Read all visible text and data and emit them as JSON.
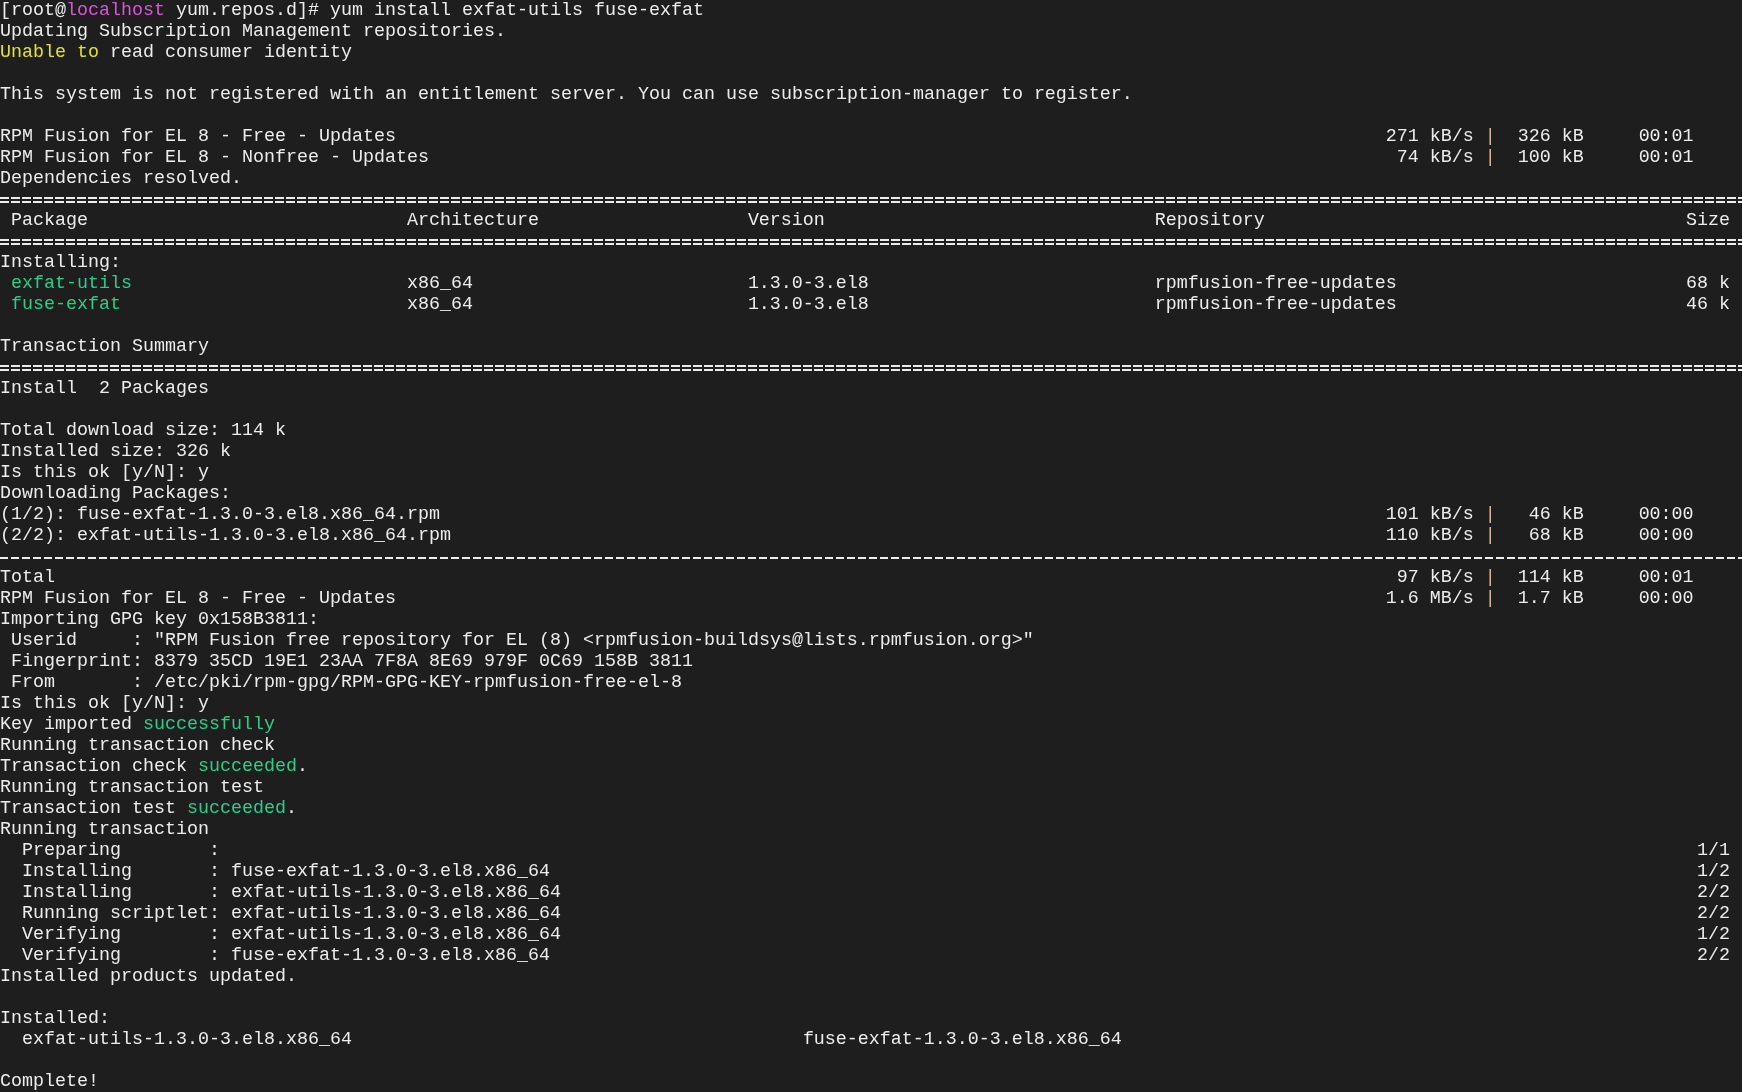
{
  "lines": [
    {
      "kind": "text",
      "segments": [
        {
          "text": "[root@"
        },
        {
          "text": "localhost",
          "color": "#e050e0"
        },
        {
          "text": " yum.repos.d]# yum install exfat-utils fuse-exfat"
        }
      ]
    },
    {
      "kind": "text",
      "segments": [
        {
          "text": "Updating Subscription Management repositories."
        }
      ]
    },
    {
      "kind": "text",
      "segments": [
        {
          "text": "Unable to",
          "color": "#e5e510"
        },
        {
          "text": " read consumer identity"
        }
      ]
    },
    {
      "kind": "blank"
    },
    {
      "kind": "text",
      "segments": [
        {
          "text": "This system is not registered with an entitlement server. You can use subscription-manager to register."
        }
      ]
    },
    {
      "kind": "blank"
    },
    {
      "kind": "progress",
      "name": "RPM Fusion for EL 8 - Free - Updates",
      "speed": "271 kB/s",
      "sep": "|",
      "size": "326 kB",
      "time": "00:01"
    },
    {
      "kind": "progress",
      "name": "RPM Fusion for EL 8 - Nonfree - Updates",
      "speed": "74 kB/s",
      "sep": "|",
      "size": "100 kB",
      "time": "00:01"
    },
    {
      "kind": "text",
      "segments": [
        {
          "text": "Dependencies resolved."
        }
      ]
    },
    {
      "kind": "rule_double"
    },
    {
      "kind": "table_header",
      "cells": [
        "Package",
        "Architecture",
        "Version",
        "Repository",
        "Size"
      ]
    },
    {
      "kind": "rule_double"
    },
    {
      "kind": "text",
      "segments": [
        {
          "text": "Installing:"
        }
      ]
    },
    {
      "kind": "table_row",
      "cells": [
        "exfat-utils",
        "x86_64",
        "1.3.0-3.el8",
        "rpmfusion-free-updates",
        "68 k"
      ]
    },
    {
      "kind": "table_row",
      "cells": [
        "fuse-exfat",
        "x86_64",
        "1.3.0-3.el8",
        "rpmfusion-free-updates",
        "46 k"
      ]
    },
    {
      "kind": "blank"
    },
    {
      "kind": "text",
      "segments": [
        {
          "text": "Transaction Summary"
        }
      ]
    },
    {
      "kind": "rule_double"
    },
    {
      "kind": "text",
      "segments": [
        {
          "text": "Install  2 Packages"
        }
      ]
    },
    {
      "kind": "blank"
    },
    {
      "kind": "text",
      "segments": [
        {
          "text": "Total download size: 114 k"
        }
      ]
    },
    {
      "kind": "text",
      "segments": [
        {
          "text": "Installed size: 326 k"
        }
      ]
    },
    {
      "kind": "text",
      "segments": [
        {
          "text": "Is this ok [y/N]: y"
        }
      ]
    },
    {
      "kind": "text",
      "segments": [
        {
          "text": "Downloading Packages:"
        }
      ]
    },
    {
      "kind": "progress",
      "name": "(1/2): fuse-exfat-1.3.0-3.el8.x86_64.rpm",
      "speed": "101 kB/s",
      "sep": "|",
      "size": "46 kB",
      "time": "00:00"
    },
    {
      "kind": "progress",
      "name": "(2/2): exfat-utils-1.3.0-3.el8.x86_64.rpm",
      "speed": "110 kB/s",
      "sep": "|",
      "size": "68 kB",
      "time": "00:00"
    },
    {
      "kind": "rule_single"
    },
    {
      "kind": "progress",
      "name": "Total",
      "speed": "97 kB/s",
      "sep": "|",
      "size": "114 kB",
      "time": "00:01"
    },
    {
      "kind": "progress",
      "name": "RPM Fusion for EL 8 - Free - Updates",
      "speed": "1.6 MB/s",
      "sep": "|",
      "size": "1.7 kB",
      "time": "00:00"
    },
    {
      "kind": "text",
      "segments": [
        {
          "text": "Importing GPG key 0x158B3811:"
        }
      ]
    },
    {
      "kind": "keyval",
      "label": "Userid",
      "sep": ":",
      "value": "\"RPM Fusion free repository for EL (8) <rpmfusion-buildsys@lists.rpmfusion.org>\""
    },
    {
      "kind": "keyval",
      "label": "Fingerprint",
      "sep": ":",
      "value": "8379 35CD 19E1 23AA 7F8A 8E69 979F 0C69 158B 3811"
    },
    {
      "kind": "keyval",
      "label": "From",
      "sep": ":",
      "value": "/etc/pki/rpm-gpg/RPM-GPG-KEY-rpmfusion-free-el-8"
    },
    {
      "kind": "text",
      "segments": [
        {
          "text": "Is this ok [y/N]: y"
        }
      ]
    },
    {
      "kind": "text",
      "segments": [
        {
          "text": "Key imported "
        },
        {
          "text": "successfully",
          "color": "#23d18b"
        }
      ]
    },
    {
      "kind": "text",
      "segments": [
        {
          "text": "Running transaction check"
        }
      ]
    },
    {
      "kind": "text",
      "segments": [
        {
          "text": "Transaction check "
        },
        {
          "text": "succeeded",
          "color": "#23d18b"
        },
        {
          "text": "."
        }
      ]
    },
    {
      "kind": "text",
      "segments": [
        {
          "text": "Running transaction test"
        }
      ]
    },
    {
      "kind": "text",
      "segments": [
        {
          "text": "Transaction test "
        },
        {
          "text": "succeeded",
          "color": "#23d18b"
        },
        {
          "text": "."
        }
      ]
    },
    {
      "kind": "text",
      "segments": [
        {
          "text": "Running transaction"
        }
      ]
    },
    {
      "kind": "step",
      "label": "Preparing",
      "sep": ":",
      "count": "1/1"
    },
    {
      "kind": "step",
      "label": "Installing",
      "sep": ":",
      "package": "fuse-exfat-1.3.0-3.el8.x86_64",
      "count": "1/2"
    },
    {
      "kind": "step",
      "label": "Installing",
      "sep": ":",
      "package": "exfat-utils-1.3.0-3.el8.x86_64",
      "count": "2/2"
    },
    {
      "kind": "step",
      "label": "Running scriptlet",
      "sep": ":",
      "package": "exfat-utils-1.3.0-3.el8.x86_64",
      "count": "2/2"
    },
    {
      "kind": "step",
      "label": "Verifying",
      "sep": ":",
      "package": "exfat-utils-1.3.0-3.el8.x86_64",
      "count": "1/2"
    },
    {
      "kind": "step",
      "label": "Verifying",
      "sep": ":",
      "package": "fuse-exfat-1.3.0-3.el8.x86_64",
      "count": "2/2"
    },
    {
      "kind": "text",
      "segments": [
        {
          "text": "Installed products updated."
        }
      ]
    },
    {
      "kind": "blank"
    },
    {
      "kind": "text",
      "segments": [
        {
          "text": "Installed:"
        }
      ]
    },
    {
      "kind": "installed",
      "packages": [
        "exfat-utils-1.3.0-3.el8.x86_64",
        "fuse-exfat-1.3.0-3.el8.x86_64"
      ]
    },
    {
      "kind": "blank"
    },
    {
      "kind": "text",
      "segments": [
        {
          "text": "Complete!"
        }
      ]
    }
  ]
}
